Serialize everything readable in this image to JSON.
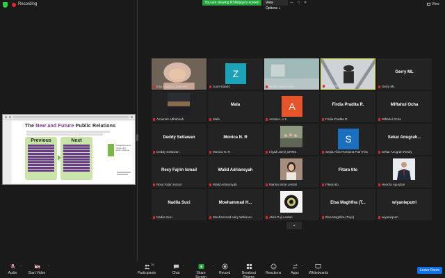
{
  "top": {
    "recording_label": "Recording",
    "viewing_banner": "You are viewing RSWijaya's screen",
    "view_options_label": "View Options",
    "view_label": "View"
  },
  "slide": {
    "title_prefix": "The ",
    "title_highlight": "New and Future",
    "title_suffix": " Public Relations",
    "previous_label": "Previous",
    "next_label": "Next",
    "side_text": "Sustainable and meaningful public relations"
  },
  "participants": [
    {
      "display": "",
      "label": "Irna Shafana Jasmine",
      "type": "photo",
      "photo": "hijab"
    },
    {
      "display": "Z",
      "label": "zoom baa04",
      "type": "avatar",
      "color": "#1ba3b8"
    },
    {
      "display": "",
      "label": "Septia wahyu klas",
      "type": "photo",
      "photo": "room"
    },
    {
      "display": "",
      "label": "RSWijaya",
      "type": "photo",
      "photo": "rsw",
      "active": true
    },
    {
      "display": "Gerry ML",
      "label": "Gerry ML",
      "type": "name"
    },
    {
      "display": "",
      "label": "Amienah Atthahirah",
      "type": "photo",
      "photo": "sunset"
    },
    {
      "display": "Mala",
      "label": "Mala",
      "type": "name"
    },
    {
      "display": "A",
      "label": "Annisa L A S",
      "type": "avatar",
      "color": "#e8542a"
    },
    {
      "display": "Firdia Pradita R.",
      "label": "Firdia Pradita R.",
      "type": "name"
    },
    {
      "display": "Miftahul Ocha",
      "label": "Miftahul Ocha",
      "type": "name"
    },
    {
      "display": "Deddy Setiawan",
      "label": "Deddy Setiawan",
      "type": "name"
    },
    {
      "display": "Monica N. R",
      "label": "Monica N. R",
      "type": "name"
    },
    {
      "display": "",
      "label": "Iriyadi Jamil_ERMS",
      "type": "photo",
      "photo": "group"
    },
    {
      "display": "S",
      "label": "Sepia Afira Purnama Putri Fira",
      "type": "avatar",
      "color": "#1a6fbf"
    },
    {
      "display": "Sekar  Anugrah...",
      "label": "Sekar Anugrah Resky",
      "type": "name"
    },
    {
      "display": "Rexy Fajrin Ismail",
      "label": "Rexy Fajrin Ismail",
      "type": "name"
    },
    {
      "display": "Walid Adriansyah",
      "label": "Walid Adriansyah",
      "type": "name"
    },
    {
      "display": "",
      "label": "Marina Sinar Lestari",
      "type": "photo",
      "photo": "woman"
    },
    {
      "display": "Fitara tito",
      "label": "Fitara tito",
      "type": "name"
    },
    {
      "display": "",
      "label": "Hendra Agustian",
      "type": "photo",
      "photo": "suit"
    },
    {
      "display": "Nadila Suci",
      "label": "Nadila Suci",
      "type": "name"
    },
    {
      "display": "Moehammad  H...",
      "label": "Moehammad Hary Wibisono",
      "type": "name"
    },
    {
      "display": "",
      "label": "Atiek Puji Lestari",
      "type": "photo",
      "photo": "logo"
    },
    {
      "display": "Elsa  Maghfira  (T...",
      "label": "Elsa Maghfira (Toya)",
      "type": "name"
    },
    {
      "display": "wiyanieputri",
      "label": "wiyanieputri",
      "type": "name"
    }
  ],
  "toolbar": {
    "audio": "Audio",
    "start_video": "Start Video",
    "participants": "Participants",
    "participants_count": "28",
    "chat": "Chat",
    "share_screen": "Share Screen",
    "record": "Record",
    "breakout_rooms": "Breakout Rooms",
    "reactions": "Reactions",
    "apps": "Apps",
    "whiteboards": "Whiteboards",
    "leave_room": "Leave Room"
  },
  "colors": {
    "accent_green": "#23a43d",
    "leave_blue": "#0e71eb",
    "active_border": "#d8e336",
    "mute_red": "#e02828"
  }
}
